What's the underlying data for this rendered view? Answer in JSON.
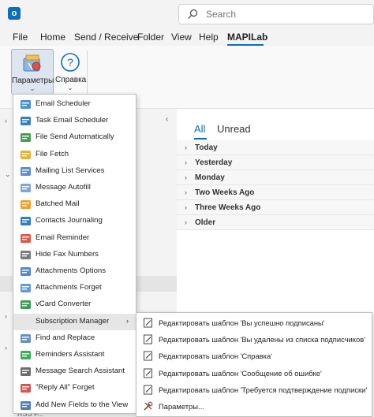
{
  "search": {
    "placeholder": "Search"
  },
  "menubar": {
    "items": [
      "File",
      "Home",
      "Send / Receive",
      "Folder",
      "View",
      "Help",
      "MAPILab"
    ]
  },
  "ribbon": {
    "settings_label": "Параметры",
    "help_label": "Справка"
  },
  "mail_view": {
    "tabs": [
      "All",
      "Unread"
    ],
    "groups": [
      "Today",
      "Yesterday",
      "Monday",
      "Two Weeks Ago",
      "Three Weeks Ago",
      "Older"
    ]
  },
  "left_pane": {
    "footer_text": "RSS F..."
  },
  "dropdown": {
    "items": [
      {
        "label": "Email Scheduler",
        "icon": "calendar-mail-icon"
      },
      {
        "label": "Task Email Scheduler",
        "icon": "task-calendar-icon"
      },
      {
        "label": "File Send Automatically",
        "icon": "file-send-icon"
      },
      {
        "label": "File Fetch",
        "icon": "file-fetch-icon"
      },
      {
        "label": "Mailing List Services",
        "icon": "mailing-list-icon"
      },
      {
        "label": "Message Autofill",
        "icon": "autofill-icon"
      },
      {
        "label": "Batched Mail",
        "icon": "batched-mail-icon"
      },
      {
        "label": "Contacts Journaling",
        "icon": "contacts-journal-icon"
      },
      {
        "label": "Email Reminder",
        "icon": "reminder-icon"
      },
      {
        "label": "Hide Fax Numbers",
        "icon": "fax-icon"
      },
      {
        "label": "Attachments Options",
        "icon": "attachment-options-icon"
      },
      {
        "label": "Attachments Forget",
        "icon": "attachment-forget-icon"
      },
      {
        "label": "vCard Converter",
        "icon": "vcard-icon"
      },
      {
        "label": "Subscription Manager",
        "icon": "",
        "has_submenu": true
      },
      {
        "label": "Find and Replace",
        "icon": "find-replace-icon"
      },
      {
        "label": "Reminders Assistant",
        "icon": "reminders-assistant-icon"
      },
      {
        "label": "Message Search Assistant",
        "icon": "message-search-icon"
      },
      {
        "label": "\"Reply All\" Forget",
        "icon": "reply-all-icon"
      },
      {
        "label": "Add New Fields to the View",
        "icon": "add-fields-icon"
      }
    ]
  },
  "submenu": {
    "items": [
      {
        "label": "Редактировать шаблон 'Вы успешно подписаны'",
        "icon": "template-icon"
      },
      {
        "label": "Редактировать шаблон 'Вы удалены из списка подписчиков'",
        "icon": "template-icon"
      },
      {
        "label": "Редактировать шаблон 'Справка'",
        "icon": "template-icon"
      },
      {
        "label": "Редактировать шаблон 'Сообщение об ошибке'",
        "icon": "template-icon"
      },
      {
        "label": "Редактировать шаблон 'Требуется подтверждение подписки'",
        "icon": "template-icon"
      },
      {
        "label": "Параметры...",
        "icon": "tools-icon"
      }
    ]
  },
  "colors": {
    "accent": "#0f6cbd"
  }
}
